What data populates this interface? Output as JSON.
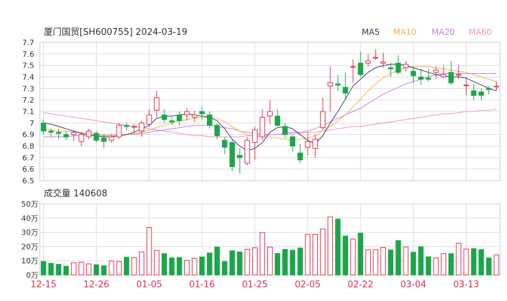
{
  "header": {
    "title": "厦门国贸[SH600755] 2024-03-19"
  },
  "colors": {
    "up": "#e0304e",
    "down": "#1aa64a",
    "ma5": "#3a3a6a",
    "ma10": "#f0b646",
    "ma20": "#c87de0",
    "ma60": "#f090c8",
    "grid": "#dddddd",
    "axis_text": "#333333",
    "date_text": "#e0304e"
  },
  "chart_data": [
    {
      "type": "candlestick",
      "panel": "price",
      "legend": [
        "MA5",
        "MA10",
        "MA20",
        "MA60"
      ],
      "ylim": [
        6.5,
        7.7
      ],
      "yticks": [
        "7.7",
        "7.6",
        "7.5",
        "7.4",
        "7.3",
        "7.2",
        "7.1",
        "7",
        "6.9",
        "6.8",
        "6.7",
        "6.6",
        "6.5"
      ],
      "x": [
        "2023-12-15",
        "2023-12-18",
        "2023-12-19",
        "2023-12-20",
        "2023-12-21",
        "2023-12-22",
        "2023-12-25",
        "2023-12-26",
        "2023-12-27",
        "2023-12-28",
        "2023-12-29",
        "2024-01-02",
        "2024-01-03",
        "2024-01-04",
        "2024-01-05",
        "2024-01-08",
        "2024-01-09",
        "2024-01-10",
        "2024-01-11",
        "2024-01-12",
        "2024-01-15",
        "2024-01-16",
        "2024-01-17",
        "2024-01-18",
        "2024-01-19",
        "2024-01-22",
        "2024-01-23",
        "2024-01-24",
        "2024-01-25",
        "2024-01-26",
        "2024-01-29",
        "2024-01-30",
        "2024-01-31",
        "2024-02-01",
        "2024-02-02",
        "2024-02-05",
        "2024-02-06",
        "2024-02-07",
        "2024-02-08",
        "2024-02-19",
        "2024-02-20",
        "2024-02-21",
        "2024-02-22",
        "2024-02-23",
        "2024-02-26",
        "2024-02-27",
        "2024-02-28",
        "2024-02-29",
        "2024-03-01",
        "2024-03-04",
        "2024-03-05",
        "2024-03-06",
        "2024-03-07",
        "2024-03-08",
        "2024-03-11",
        "2024-03-12",
        "2024-03-13",
        "2024-03-14",
        "2024-03-15",
        "2024-03-18",
        "2024-03-19"
      ],
      "open": [
        7.0,
        6.93,
        6.92,
        6.9,
        6.9,
        6.84,
        6.88,
        6.91,
        6.87,
        6.85,
        6.88,
        6.98,
        6.97,
        6.93,
        6.99,
        7.11,
        7.07,
        7.02,
        7.07,
        7.07,
        7.05,
        7.1,
        7.07,
        6.98,
        6.85,
        6.83,
        6.72,
        6.65,
        6.83,
        6.88,
        7.06,
        7.06,
        6.97,
        6.88,
        6.74,
        6.79,
        6.78,
        6.96,
        7.32,
        7.34,
        7.31,
        7.49,
        7.52,
        7.52,
        7.57,
        7.52,
        7.48,
        7.52,
        7.48,
        7.45,
        7.4,
        7.39,
        7.44,
        7.4,
        7.44,
        7.42,
        7.33,
        7.28,
        7.27,
        7.3,
        7.32
      ],
      "close": [
        6.93,
        6.92,
        6.91,
        6.88,
        6.92,
        6.9,
        6.93,
        6.85,
        6.84,
        6.88,
        6.98,
        6.97,
        6.97,
        7.0,
        7.07,
        7.22,
        7.03,
        7.01,
        7.02,
        7.1,
        7.07,
        7.08,
        6.98,
        6.89,
        6.79,
        6.62,
        6.7,
        6.85,
        6.94,
        7.05,
        7.1,
        6.98,
        6.9,
        6.8,
        6.68,
        6.84,
        6.86,
        7.1,
        7.35,
        7.33,
        7.26,
        7.49,
        7.42,
        7.54,
        7.57,
        7.53,
        7.47,
        7.44,
        7.51,
        7.41,
        7.38,
        7.38,
        7.46,
        7.42,
        7.35,
        7.42,
        7.33,
        7.24,
        7.24,
        7.29,
        7.32
      ],
      "high": [
        7.03,
        6.95,
        6.95,
        6.93,
        6.94,
        6.92,
        6.95,
        6.93,
        6.9,
        6.9,
        7.0,
        7.0,
        6.99,
        7.02,
        7.12,
        7.28,
        7.12,
        7.05,
        7.1,
        7.13,
        7.11,
        7.14,
        7.1,
        7.0,
        6.88,
        6.86,
        6.78,
        6.88,
        6.97,
        7.12,
        7.2,
        7.12,
        7.0,
        6.9,
        6.82,
        6.92,
        6.9,
        7.22,
        7.49,
        7.42,
        7.44,
        7.55,
        7.62,
        7.6,
        7.64,
        7.61,
        7.52,
        7.59,
        7.54,
        7.49,
        7.47,
        7.47,
        7.49,
        7.5,
        7.54,
        7.5,
        7.4,
        7.34,
        7.3,
        7.32,
        7.36
      ],
      "low": [
        6.9,
        6.88,
        6.86,
        6.85,
        6.84,
        6.8,
        6.86,
        6.83,
        6.78,
        6.83,
        6.86,
        6.93,
        6.91,
        6.88,
        6.97,
        7.05,
        7.0,
        6.98,
        6.98,
        7.02,
        7.01,
        7.03,
        6.95,
        6.86,
        6.73,
        6.58,
        6.56,
        6.63,
        6.68,
        6.85,
        6.99,
        6.97,
        6.87,
        6.75,
        6.65,
        6.72,
        6.7,
        6.94,
        7.1,
        7.28,
        7.2,
        7.35,
        7.4,
        7.49,
        7.55,
        7.48,
        7.4,
        7.42,
        7.45,
        7.35,
        7.33,
        7.36,
        7.38,
        7.39,
        7.33,
        7.38,
        7.24,
        7.2,
        7.2,
        7.25,
        7.28
      ],
      "ma5": [
        7.0,
        6.99,
        6.97,
        6.95,
        6.93,
        6.91,
        6.9,
        6.89,
        6.88,
        6.88,
        6.89,
        6.9,
        6.92,
        6.95,
        6.98,
        7.04,
        7.06,
        7.06,
        7.07,
        7.08,
        7.07,
        7.06,
        7.05,
        7.02,
        6.95,
        6.86,
        6.8,
        6.76,
        6.78,
        6.83,
        6.92,
        6.96,
        6.97,
        6.95,
        6.9,
        6.85,
        6.82,
        6.89,
        7.0,
        7.1,
        7.21,
        7.32,
        7.38,
        7.44,
        7.48,
        7.5,
        7.51,
        7.51,
        7.5,
        7.48,
        7.46,
        7.44,
        7.42,
        7.41,
        7.4,
        7.4,
        7.39,
        7.36,
        7.33,
        7.3,
        7.28
      ],
      "ma10": [
        6.95,
        6.94,
        6.93,
        6.93,
        6.92,
        6.92,
        6.92,
        6.91,
        6.9,
        6.9,
        6.9,
        6.9,
        6.91,
        6.92,
        6.94,
        6.96,
        6.98,
        7.0,
        7.02,
        7.03,
        7.04,
        7.05,
        7.05,
        7.04,
        7.01,
        6.97,
        6.93,
        6.9,
        6.88,
        6.88,
        6.88,
        6.87,
        6.86,
        6.85,
        6.86,
        6.87,
        6.89,
        6.93,
        6.97,
        7.02,
        7.07,
        7.14,
        7.21,
        7.28,
        7.34,
        7.39,
        7.43,
        7.46,
        7.48,
        7.49,
        7.49,
        7.49,
        7.48,
        7.47,
        7.46,
        7.45,
        7.44,
        7.42,
        7.4,
        7.38,
        7.36
      ],
      "ma20": [
        6.88,
        6.88,
        6.88,
        6.88,
        6.89,
        6.89,
        6.89,
        6.89,
        6.89,
        6.89,
        6.89,
        6.9,
        6.9,
        6.91,
        6.92,
        6.93,
        6.94,
        6.95,
        6.96,
        6.97,
        6.98,
        6.98,
        6.98,
        6.97,
        6.96,
        6.95,
        6.93,
        6.92,
        6.91,
        6.9,
        6.9,
        6.9,
        6.91,
        6.92,
        6.92,
        6.93,
        6.95,
        6.98,
        7.01,
        7.04,
        7.07,
        7.1,
        7.13,
        7.17,
        7.21,
        7.25,
        7.28,
        7.31,
        7.34,
        7.36,
        7.38,
        7.4,
        7.42,
        7.43,
        7.43,
        7.43,
        7.43,
        7.43,
        7.43,
        7.43,
        7.43
      ],
      "ma60": [
        7.09,
        7.08,
        7.07,
        7.06,
        7.05,
        7.04,
        7.03,
        7.02,
        7.01,
        7.0,
        6.99,
        6.98,
        6.97,
        6.96,
        6.95,
        6.94,
        6.93,
        6.92,
        6.91,
        6.9,
        6.89,
        6.89,
        6.88,
        6.88,
        6.88,
        6.88,
        6.88,
        6.89,
        6.89,
        6.89,
        6.9,
        6.9,
        6.9,
        6.91,
        6.91,
        6.92,
        6.92,
        6.93,
        6.94,
        6.95,
        6.96,
        6.97,
        6.97,
        6.98,
        6.99,
        7.0,
        7.01,
        7.02,
        7.03,
        7.04,
        7.05,
        7.06,
        7.07,
        7.08,
        7.08,
        7.09,
        7.1,
        7.1,
        7.11,
        7.11,
        7.12
      ]
    },
    {
      "type": "bar",
      "panel": "volume",
      "label": "成交量 140608",
      "ylim": [
        0,
        50
      ],
      "yticks": [
        "50万",
        "40万",
        "30万",
        "20万",
        "10万",
        "0万"
      ],
      "xticks": [
        {
          "index": 0,
          "label": "12-15"
        },
        {
          "index": 7,
          "label": "12-26"
        },
        {
          "index": 14,
          "label": "01-05"
        },
        {
          "index": 21,
          "label": "01-16"
        },
        {
          "index": 28,
          "label": "01-25"
        },
        {
          "index": 35,
          "label": "02-05"
        },
        {
          "index": 42,
          "label": "02-22"
        },
        {
          "index": 49,
          "label": "03-04"
        },
        {
          "index": 56,
          "label": "03-13"
        }
      ],
      "values": [
        9.5,
        8.2,
        7.5,
        6.2,
        8.6,
        9.0,
        7.8,
        7.2,
        6.5,
        9.8,
        9.4,
        12.5,
        12.2,
        16.3,
        33.4,
        17.2,
        15.0,
        12.0,
        12.3,
        10.3,
        11.8,
        12.7,
        15.5,
        19.6,
        9.5,
        17.0,
        16.2,
        18.1,
        19.2,
        29.8,
        19.6,
        15.1,
        18.0,
        17.4,
        19.0,
        28.5,
        28.6,
        32.3,
        40.8,
        39.3,
        27.4,
        25.3,
        29.4,
        17.7,
        17.9,
        19.4,
        17.6,
        24.2,
        19.7,
        16.0,
        19.9,
        12.8,
        12.0,
        15.1,
        15.0,
        22.3,
        18.2,
        18.5,
        17.9,
        12.0,
        14.1
      ]
    }
  ]
}
